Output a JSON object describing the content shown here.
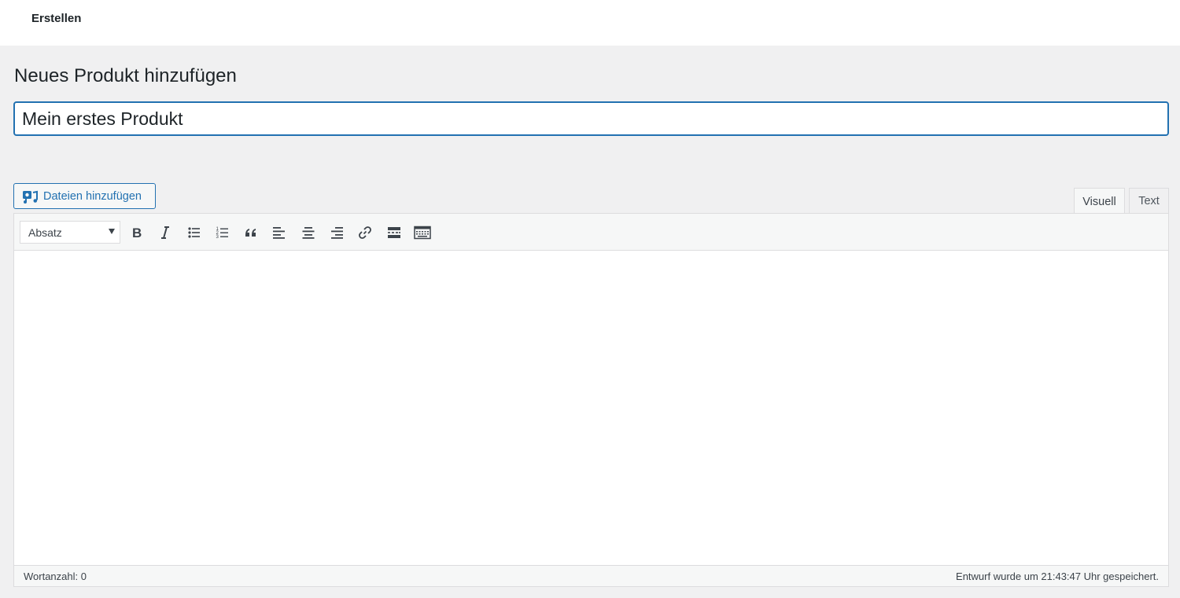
{
  "topbar": {
    "title": "Erstellen"
  },
  "page": {
    "heading": "Neues Produkt hinzufügen"
  },
  "title_field": {
    "value": "Mein erstes Produkt"
  },
  "media": {
    "button_label": "Dateien hinzufügen"
  },
  "editor_tabs": [
    {
      "label": "Visuell",
      "active": true
    },
    {
      "label": "Text",
      "active": false
    }
  ],
  "toolbar": {
    "format_selected": "Absatz",
    "buttons": [
      "bold-icon",
      "italic-icon",
      "bulleted-list-icon",
      "numbered-list-icon",
      "blockquote-icon",
      "align-left-icon",
      "align-center-icon",
      "align-right-icon",
      "insert-link-icon",
      "read-more-icon",
      "toolbar-toggle-icon"
    ]
  },
  "status": {
    "word_count": "Wortanzahl: 0",
    "autosave": "Entwurf wurde um 21:43:47 Uhr gespeichert."
  },
  "colors": {
    "accent": "#2271b1",
    "background": "#f0f0f1",
    "text": "#1d2327",
    "border": "#dcdcde"
  }
}
